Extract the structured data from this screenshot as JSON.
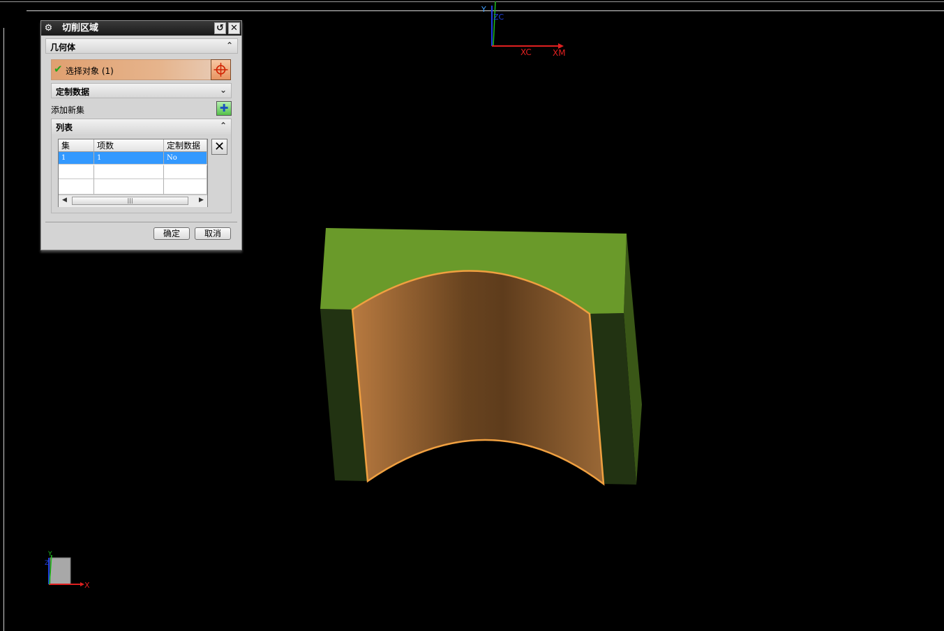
{
  "dialog": {
    "title": "切削区域",
    "geometry_section": "几何体",
    "select_object_label": "选择对象 (1)",
    "custom_data_section": "定制数据",
    "add_new_set_label": "添加新集",
    "list_section": "列表",
    "table": {
      "columns": [
        "集",
        "项数",
        "定制数据"
      ],
      "rows": [
        [
          "1",
          "1",
          "No"
        ]
      ]
    },
    "ok_label": "确定",
    "cancel_label": "取消"
  },
  "wcs_axes": {
    "y_label": "Y",
    "zc_label": "ZC",
    "xc_label": "XC",
    "xm_label": "XM"
  },
  "triad": {
    "x_label": "X",
    "y_label": "Y",
    "z_label": "Z"
  },
  "colors": {
    "viewport_bg": "#000000",
    "block_top": "#6a9a2a",
    "block_side_dark": "#223310",
    "block_side_right": "#3c5a18",
    "cut_face": "#7a4c26",
    "edge_highlight": "#f0a040",
    "selection_row": "#3399ff",
    "x_axis": "#e02020",
    "z_axis": "#2040e0",
    "y_axis": "#20c020"
  }
}
